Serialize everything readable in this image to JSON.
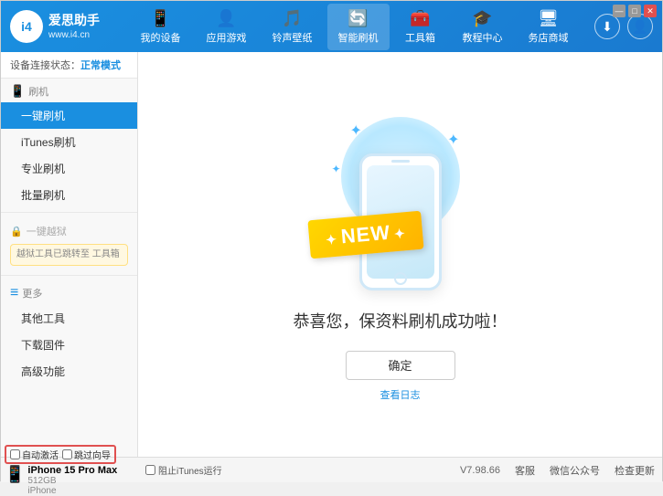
{
  "app": {
    "title": "爱思助手",
    "subtitle": "www.i4.cn",
    "logo_char": "i4"
  },
  "window_controls": {
    "minimize": "—",
    "maximize": "□",
    "close": "✕"
  },
  "nav": {
    "tabs": [
      {
        "id": "my-device",
        "icon": "📱",
        "label": "我的设备"
      },
      {
        "id": "apps-games",
        "icon": "👤",
        "label": "应用游戏"
      },
      {
        "id": "ringtones",
        "icon": "🎵",
        "label": "铃声壁纸"
      },
      {
        "id": "smart-flash",
        "icon": "🔄",
        "label": "智能刷机",
        "active": true
      },
      {
        "id": "toolbox",
        "icon": "🧰",
        "label": "工具箱"
      },
      {
        "id": "tutorial",
        "icon": "🎓",
        "label": "教程中心"
      },
      {
        "id": "service",
        "icon": "🖥",
        "label": "务店商域"
      }
    ]
  },
  "header_right": {
    "download_icon": "⬇",
    "user_icon": "👤"
  },
  "sidebar": {
    "status_label": "设备连接状态：",
    "status_value": "正常模式",
    "sections": [
      {
        "id": "flash",
        "icon": "📱",
        "label": "刷机",
        "items": [
          {
            "id": "one-key-flash",
            "label": "一键刷机",
            "active": true
          },
          {
            "id": "itunes-flash",
            "label": "iTunes刷机"
          },
          {
            "id": "pro-flash",
            "label": "专业刷机"
          },
          {
            "id": "batch-flash",
            "label": "批量刷机"
          }
        ]
      },
      {
        "id": "one-key-jailbreak",
        "icon": "🔒",
        "label": "一键越狱",
        "locked": true,
        "notice": "越狱工具已跳转至\n工具箱"
      },
      {
        "id": "more",
        "icon": "≡",
        "label": "更多",
        "items": [
          {
            "id": "other-tools",
            "label": "其他工具"
          },
          {
            "id": "download-firmware",
            "label": "下载固件"
          },
          {
            "id": "advanced",
            "label": "高级功能"
          }
        ]
      }
    ]
  },
  "content": {
    "success_text": "恭喜您，保资料刷机成功啦！",
    "confirm_btn": "确定",
    "log_link": "查看日志",
    "new_badge": "NEW"
  },
  "bottom": {
    "auto_activate_label": "自动激活",
    "guide_activate_label": "跳过向导",
    "device_name": "iPhone 15 Pro Max",
    "device_storage": "512GB",
    "device_type": "iPhone",
    "version": "V7.98.66",
    "links": [
      "客服",
      "微信公众号",
      "检查更新"
    ],
    "itunes_label": "阻止iTunes运行"
  }
}
